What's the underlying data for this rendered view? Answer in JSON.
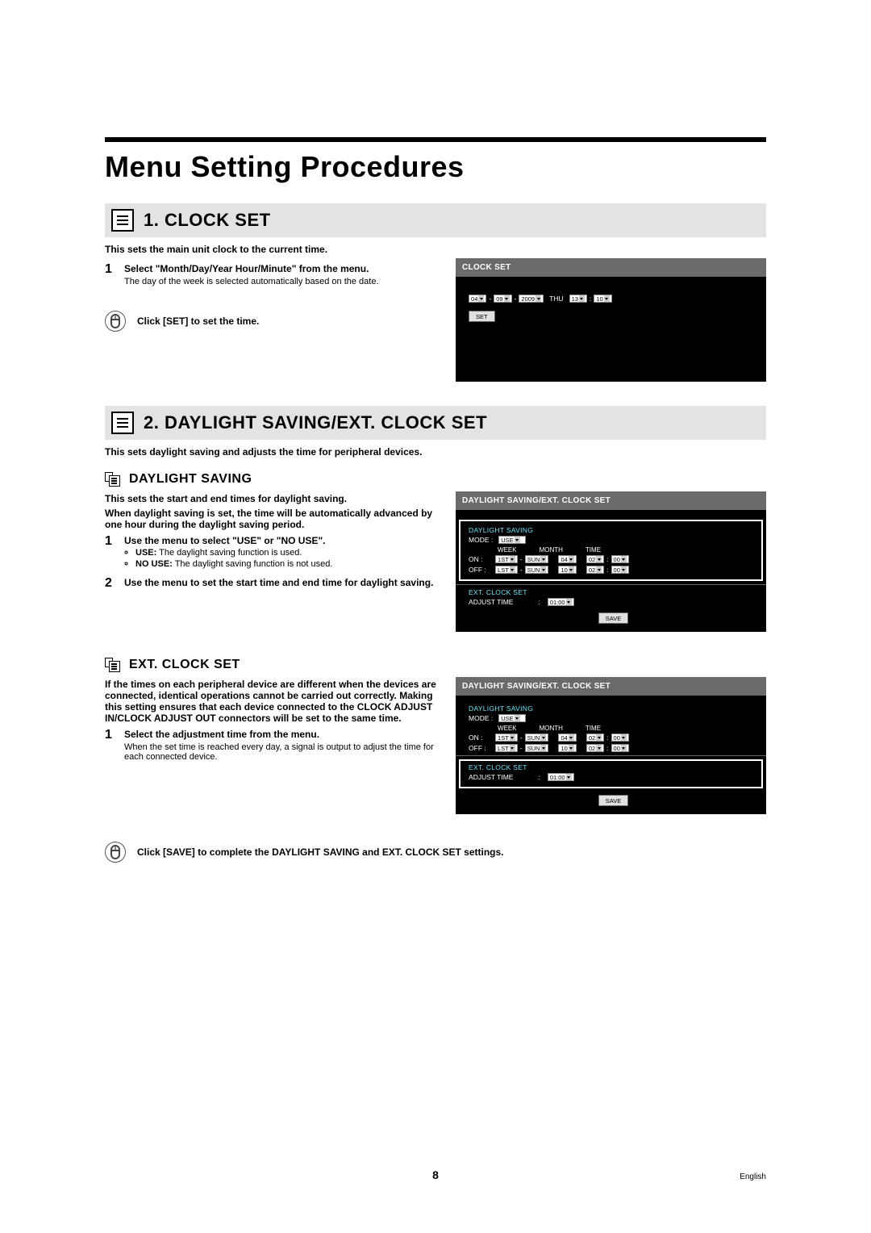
{
  "page": {
    "title": "Menu Setting Procedures",
    "page_number": "8",
    "language": "English"
  },
  "section1": {
    "heading": "1.  CLOCK SET",
    "intro": "This sets the main unit clock to the current time.",
    "step1": {
      "num": "1",
      "bold": "Select \"Month/Day/Year Hour/Minute\" from the menu.",
      "note": "The day of the week is selected automatically based on the date."
    },
    "mouse": "Click [SET] to set the time."
  },
  "clock_panel": {
    "title": "CLOCK SET",
    "month": "04",
    "day": "09",
    "year": "2009",
    "weekday": "THU",
    "hour": "13",
    "minute": "10",
    "set_btn": "SET"
  },
  "section2": {
    "heading": "2.  DAYLIGHT SAVING/EXT. CLOCK SET",
    "intro": "This sets daylight saving and adjusts the time for peripheral devices."
  },
  "daylight": {
    "heading": "DAYLIGHT SAVING",
    "intro": "This sets the start and end times for daylight saving.",
    "desc": "When daylight saving is set, the time will be automatically advanced by one hour during the daylight saving period.",
    "step1": {
      "num": "1",
      "bold": "Use the menu to select \"USE\" or \"NO USE\"."
    },
    "bullets": {
      "use_label": "USE:",
      "use_text": "The daylight saving function is used.",
      "nouse_label": "NO USE:",
      "nouse_text": "The daylight saving function is not used."
    },
    "step2": {
      "num": "2",
      "bold": "Use the menu to set the start time and end time for daylight saving."
    }
  },
  "ext": {
    "heading": "EXT. CLOCK SET",
    "desc": "If the times on each peripheral device are different when the devices are connected, identical operations cannot be carried out correctly. Making this setting ensures that each device connected to the CLOCK ADJUST IN/CLOCK ADJUST OUT connectors will be set to the same time.",
    "step1": {
      "num": "1",
      "bold": "Select the adjustment time from the menu.",
      "note": "When the set time is reached every day, a signal is output to adjust the time for each connected device."
    }
  },
  "dst_panel": {
    "title": "DAYLIGHT SAVING/EXT. CLOCK SET",
    "sect_ds": "DAYLIGHT SAVING",
    "mode_lbl": "MODE :",
    "mode_val": "USE",
    "col_week": "WEEK",
    "col_month": "MONTH",
    "col_time": "TIME",
    "on_lbl": "ON :",
    "off_lbl": "OFF :",
    "on_week1": "1ST",
    "on_week2": "SUN",
    "on_month": "04",
    "on_h": "02",
    "on_m": "00",
    "off_week1": "LST",
    "off_week2": "SUN",
    "off_month": "10",
    "off_h": "02",
    "off_m": "00",
    "sect_ext": "EXT. CLOCK SET",
    "adj_lbl": "ADJUST TIME",
    "adj_val": "01:00",
    "save_btn": "SAVE"
  },
  "final_mouse": "Click [SAVE] to complete the DAYLIGHT SAVING and EXT. CLOCK SET settings."
}
